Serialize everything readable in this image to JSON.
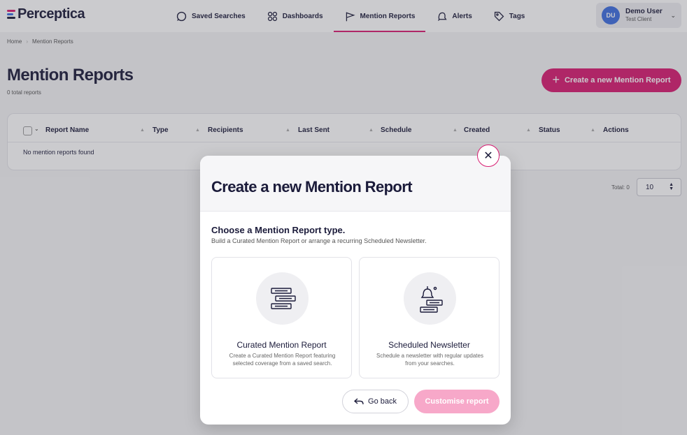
{
  "brand": {
    "name": "Perceptica",
    "accent": "#d81b71",
    "logo_colors": [
      "#d81b71",
      "#3d6ee0",
      "#1b1b3a"
    ]
  },
  "nav": {
    "items": [
      {
        "label": "Saved Searches",
        "icon": "search-icon"
      },
      {
        "label": "Dashboards",
        "icon": "grid-icon"
      },
      {
        "label": "Mention Reports",
        "icon": "flag-icon",
        "active": true
      },
      {
        "label": "Alerts",
        "icon": "bell-icon"
      },
      {
        "label": "Tags",
        "icon": "tag-icon"
      }
    ]
  },
  "user": {
    "initials": "DU",
    "name": "Demo User",
    "client": "Test Client"
  },
  "breadcrumb": {
    "home": "Home",
    "separator": "›",
    "current": "Mention Reports"
  },
  "page": {
    "title": "Mention Reports",
    "subtitle": "0 total reports",
    "create_button": "Create a new Mention Report"
  },
  "table": {
    "columns": [
      "Report Name",
      "Type",
      "Recipients",
      "Last Sent",
      "Schedule",
      "Created",
      "Status",
      "Actions"
    ],
    "empty_text": "No mention reports found"
  },
  "pager": {
    "total_label": "Total: 0",
    "page_size": "10"
  },
  "modal": {
    "title": "Create a new Mention Report",
    "close_label": "✕",
    "choose_title": "Choose a Mention Report type.",
    "choose_subtitle": "Build a Curated Mention Report or arrange a recurring Scheduled Newsletter.",
    "options": [
      {
        "title": "Curated Mention Report",
        "description": "Create a Curated Mention Report featuring selected coverage from a saved search.",
        "icon": "stacked-bars-icon"
      },
      {
        "title": "Scheduled Newsletter",
        "description": "Schedule a newsletter with regular updates from your searches.",
        "icon": "bell-bars-icon"
      }
    ],
    "back_button": "Go back",
    "customise_button": "Customise report"
  }
}
